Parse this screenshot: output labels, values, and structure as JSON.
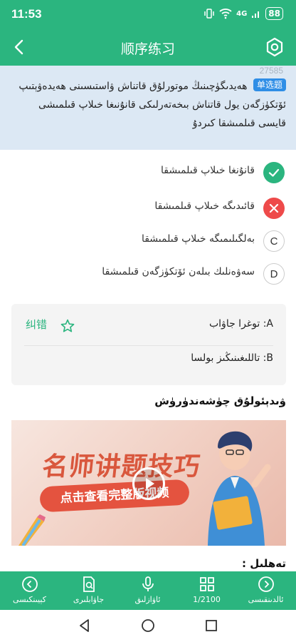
{
  "status": {
    "time": "11:53",
    "battery": "88",
    "signal": "4G"
  },
  "header": {
    "title": "顺序练习"
  },
  "question": {
    "number": "27585",
    "type_badge": "单选题",
    "text": "ھەيدىگۈچىنىڭ موتورلۇق قاتناش ۋاستىسىنى ھەيدەۋېتىپ ئۆتكۈزگەن يول قاتناش بىخەتەرلىكى قانۇنىغا خىلاپ قىلمىشى قايسى قىلمىشقا كىردۇ"
  },
  "options": [
    {
      "key": "A",
      "status": "correct",
      "label": "قانۇنغا خىلاپ قىلمىشقا"
    },
    {
      "key": "B",
      "status": "wrong",
      "label": "قائىدىگە خىلاپ قىلمىشقا"
    },
    {
      "key": "C",
      "status": "plain",
      "label": "بەلگىلىمىگە خىلاپ قىلمىشقا"
    },
    {
      "key": "D",
      "status": "plain",
      "label": "سەۋەنلىك بىلەن ئۆتكۈزگەن قىلمىشقا"
    }
  ],
  "answer": {
    "report_label": "纠错",
    "correct_row": "A: توغرا جاۋاب",
    "your_row": "B: تاللىغىنىڭىز بولسا"
  },
  "video": {
    "section_title": "ۋىدېئولۇق چۈشەندۈرۈش",
    "headline": "名师讲题技巧",
    "subline": "点击查看完整版视频"
  },
  "analysis": {
    "title": "تەھلىل :"
  },
  "bottom_bar": [
    {
      "icon": "chevron-left-circle-icon",
      "label": "كېيىنكىسى"
    },
    {
      "icon": "answer-sheet-icon",
      "label": "جاۋابلىرى"
    },
    {
      "icon": "microphone-icon",
      "label": "ئاۋازلىق"
    },
    {
      "icon": "grid-icon",
      "label": "1/2100"
    },
    {
      "icon": "chevron-right-circle-icon",
      "label": "ئالدىنقىسى"
    }
  ],
  "colors": {
    "accent": "#2bb57f",
    "wrong": "#ee4a4a",
    "badge": "#2f8ee6",
    "question_bg": "#dce8f4"
  }
}
